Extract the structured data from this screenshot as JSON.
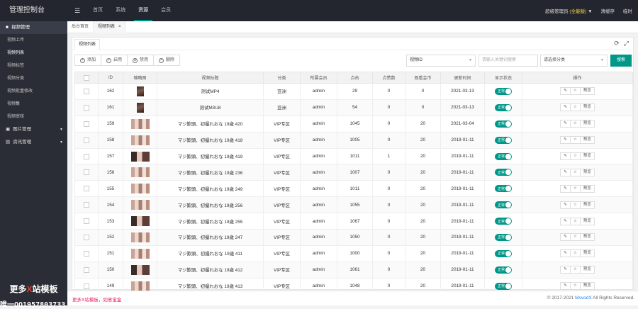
{
  "app": {
    "title": "管理控制台",
    "nav": [
      "首页",
      "系统",
      "资源",
      "会员"
    ],
    "nav_active": "资源",
    "user_label": "超级管理员",
    "user_role": "(全能版)",
    "clear_cache": "清缓存",
    "logout": "临时"
  },
  "sidebar": {
    "groups": [
      {
        "label": "视频管理",
        "icon": "video-icon",
        "open": true,
        "items": [
          "视频上传",
          "视频列表",
          "视频标签",
          "视频分类",
          "视频批量修改",
          "视频集",
          "视频审核"
        ],
        "active_item": "视频列表"
      },
      {
        "label": "图片管理",
        "icon": "image-icon",
        "open": false
      },
      {
        "label": "资讯管理",
        "icon": "news-icon",
        "open": false
      }
    ],
    "watermark_line1_a": "更多",
    "watermark_line1_x": "X",
    "watermark_line1_b": "站模板",
    "watermark_line2": "唯一QQ1957803733"
  },
  "tabs": [
    {
      "label": "后台首页",
      "closable": false
    },
    {
      "label": "视频列表",
      "closable": true,
      "close": "×",
      "active": true
    }
  ],
  "panel": {
    "tab_label": "视频列表",
    "refresh_icon": "refresh-icon",
    "fullscreen_icon": "fullscreen-icon",
    "actions": [
      {
        "label": "添加",
        "symbol": "+"
      },
      {
        "label": "启用",
        "symbol": "✓"
      },
      {
        "label": "禁用",
        "symbol": "⊘"
      },
      {
        "label": "删除",
        "symbol": "×"
      }
    ],
    "search_field": "视频ID",
    "search_placeholder": "请输入关键词搜索",
    "category_placeholder": "请选择分类",
    "search_button": "搜索",
    "arrow_down": "▼"
  },
  "table": {
    "headers": [
      "",
      "ID",
      "缩略图",
      "视频标题",
      "分类",
      "所属会员",
      "点击",
      "点赞数",
      "观看金币",
      "更新时间",
      "显示状态",
      "操作"
    ],
    "status_label": "正常",
    "row_actions": [
      "✎",
      "☆",
      "预览"
    ],
    "rows": [
      {
        "id": "162",
        "thumb": "portrait",
        "title": "测试MP4",
        "category": "亚洲",
        "member": "admin",
        "clicks": "29",
        "likes": "0",
        "coins": "0",
        "updated": "2021-03-13"
      },
      {
        "id": "161",
        "thumb": "portrait",
        "title": "测试M3U8",
        "category": "亚洲",
        "member": "admin",
        "clicks": "54",
        "likes": "0",
        "coins": "0",
        "updated": "2021-03-13"
      },
      {
        "id": "159",
        "thumb": "strip",
        "title": "マジ歎頭、初撮れおな 19歳 420",
        "category": "VIP专区",
        "member": "admin",
        "clicks": "1045",
        "likes": "0",
        "coins": "20",
        "updated": "2021-03-04"
      },
      {
        "id": "158",
        "thumb": "strip",
        "title": "マジ歎頭、初撮れおな 19歳 418",
        "category": "VIP专区",
        "member": "admin",
        "clicks": "1005",
        "likes": "0",
        "coins": "20",
        "updated": "2019-01-11"
      },
      {
        "id": "157",
        "thumb": "dark",
        "title": "マジ歎頭、初撮れおな 19歳 419",
        "category": "VIP专区",
        "member": "admin",
        "clicks": "1011",
        "likes": "1",
        "coins": "20",
        "updated": "2019-01-11"
      },
      {
        "id": "156",
        "thumb": "strip",
        "title": "マジ歎頭、初撮れおな 19歳 236",
        "category": "VIP专区",
        "member": "admin",
        "clicks": "1007",
        "likes": "0",
        "coins": "20",
        "updated": "2019-01-11"
      },
      {
        "id": "155",
        "thumb": "strip",
        "title": "マジ歎頭、初撮れおな 19歳 249",
        "category": "VIP专区",
        "member": "admin",
        "clicks": "1011",
        "likes": "0",
        "coins": "20",
        "updated": "2019-01-11"
      },
      {
        "id": "154",
        "thumb": "strip",
        "title": "マジ歎頭、初撮れおな 19歳 256",
        "category": "VIP专区",
        "member": "admin",
        "clicks": "1055",
        "likes": "0",
        "coins": "20",
        "updated": "2019-01-11"
      },
      {
        "id": "153",
        "thumb": "dark",
        "title": "マジ歎頭、初撮れおな 19歳 255",
        "category": "VIP专区",
        "member": "admin",
        "clicks": "1067",
        "likes": "0",
        "coins": "20",
        "updated": "2019-01-11"
      },
      {
        "id": "152",
        "thumb": "strip",
        "title": "マジ歎頭、初撮れおな 19歳 247",
        "category": "VIP专区",
        "member": "admin",
        "clicks": "1050",
        "likes": "0",
        "coins": "20",
        "updated": "2019-01-11"
      },
      {
        "id": "151",
        "thumb": "strip",
        "title": "マジ歎頭、初撮れおな 19歳 411",
        "category": "VIP专区",
        "member": "admin",
        "clicks": "1000",
        "likes": "0",
        "coins": "20",
        "updated": "2019-01-11"
      },
      {
        "id": "150",
        "thumb": "dark",
        "title": "マジ歎頭、初撮れおな 19歳 412",
        "category": "VIP专区",
        "member": "admin",
        "clicks": "1061",
        "likes": "0",
        "coins": "20",
        "updated": "2019-01-11"
      },
      {
        "id": "149",
        "thumb": "strip",
        "title": "マジ歎頭、初撮れおな 19歳 413",
        "category": "VIP专区",
        "member": "admin",
        "clicks": "1048",
        "likes": "0",
        "coins": "20",
        "updated": "2019-01-11"
      }
    ]
  },
  "footer": {
    "left": "更多X站模板，如意宝盒",
    "right_prefix": "© 2017-2021 ",
    "brand": "MsvodX",
    "right_suffix": " All Rights Reserved."
  }
}
